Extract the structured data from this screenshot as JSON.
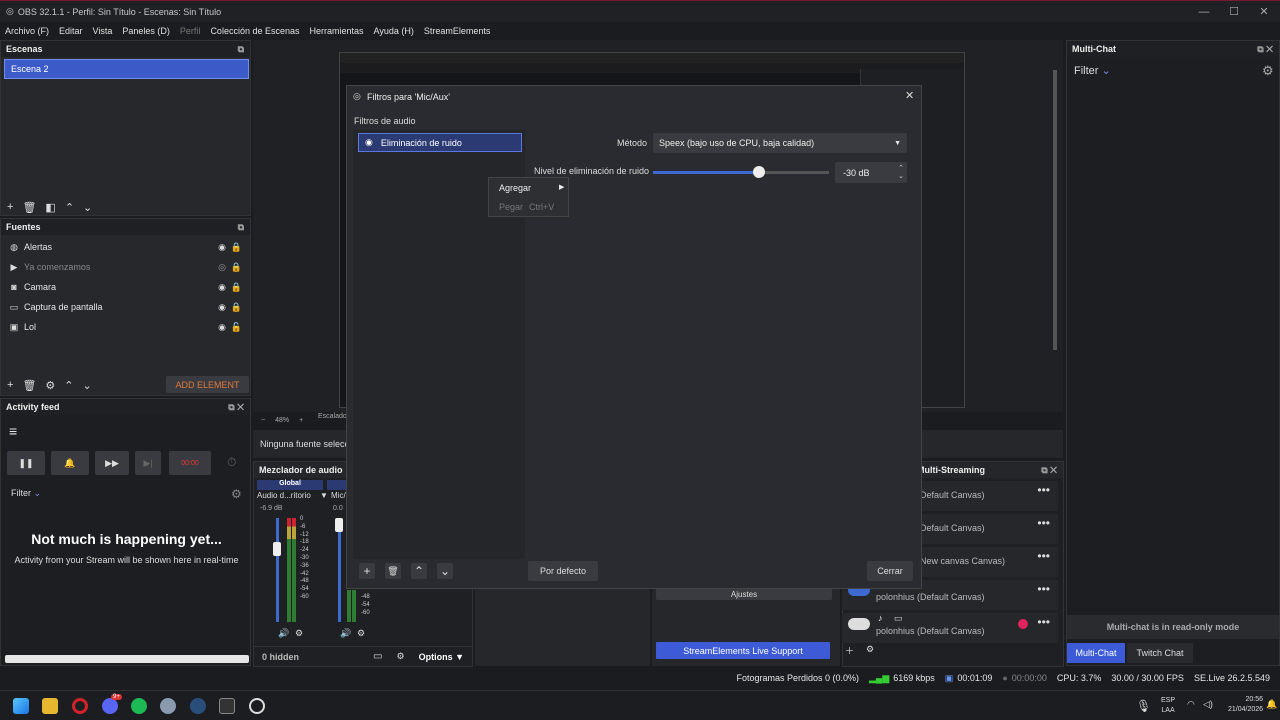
{
  "window": {
    "title": "OBS 32.1.1 - Perfil: Sin Título - Escenas: Sin Título",
    "min": "—",
    "max": "☐",
    "close": "✕"
  },
  "menu": [
    "Archivo (F)",
    "Editar",
    "Vista",
    "Paneles (D)",
    "Perfil",
    "Colección de Escenas",
    "Herramientas",
    "Ayuda (H)",
    "StreamElements"
  ],
  "scenes": {
    "title": "Escenas",
    "items": [
      "Escena 2"
    ]
  },
  "sources": {
    "title": "Fuentes",
    "items": [
      {
        "label": "Alertas",
        "icon": "globe-icon"
      },
      {
        "label": "Ya comenzamos",
        "icon": "play-icon",
        "hidden": true
      },
      {
        "label": "Camara",
        "icon": "camera-icon"
      },
      {
        "label": "Captura de pantalla",
        "icon": "monitor-icon"
      },
      {
        "label": "Lol",
        "icon": "window-icon"
      }
    ],
    "add_element": "ADD ELEMENT"
  },
  "activity": {
    "title": "Activity feed",
    "rec_time": "00:00",
    "filter": "Filter",
    "empty_title": "Not much is happening yet...",
    "empty_sub": "Activity from your Stream will be shown here in real-time"
  },
  "preview": {
    "zoom": "48%",
    "scale": "Escalado (",
    "no_source": "Ninguna fuente selecc"
  },
  "mixer": {
    "title": "Mezclador de audio",
    "global": "Global",
    "ch1": {
      "name": "Audio d...ritorio",
      "db": "-6.9 dB"
    },
    "ch2": {
      "name": "Mic/",
      "db": "0.0"
    },
    "scale": [
      "0",
      "-6",
      "-12",
      "-18",
      "-24",
      "-30",
      "-36",
      "-42",
      "-48",
      "-54",
      "-60"
    ],
    "hidden": "0 hidden",
    "options": "Options"
  },
  "dialog": {
    "title": "Filtros para 'Mic/Aux'",
    "section": "Filtros de audio",
    "filter_item": "Eliminación de ruido",
    "method_label": "Método",
    "method_value": "Speex (bajo uso de CPU, baja calidad)",
    "level_label": "Nivel de eliminación de ruido",
    "level_value": "-30 dB",
    "level_fraction": 0.6,
    "defaults": "Por defecto",
    "close": "Cerrar",
    "context": {
      "add": "Agregar",
      "paste": "Pegar",
      "paste_shortcut": "Ctrl+V"
    }
  },
  "controls": {
    "ajustes": "Ajustes",
    "support": "StreamElements Live Support"
  },
  "multistream": {
    "title": "Multi-Streaming",
    "rows": [
      "Default Canvas)",
      "Default Canvas)",
      "New canvas Canvas)",
      "polonhius (Default Canvas)",
      "polonhius (Default Canvas)"
    ]
  },
  "multichat": {
    "title": "Multi-Chat",
    "filter": "Filter",
    "readonly": "Multi-chat is in read-only mode",
    "tab1": "Multi-Chat",
    "tab2": "Twitch Chat"
  },
  "status": {
    "dropped": "Fotogramas Perdidos 0 (0.0%)",
    "bitrate": "6169 kbps",
    "rec": "00:01:09",
    "stream": "00:00:00",
    "cpu": "CPU: 3.7%",
    "fps": "30.00 / 30.00 FPS",
    "se": "SE.Live 26.2.5.549"
  },
  "taskbar": {
    "lang1": "ESP",
    "lang2": "LAA",
    "time": "20:56",
    "date": "21/04/2026",
    "discord_badge": "9+"
  },
  "colors": {
    "accent": "#3c5bc8",
    "brand_red": "#7a1830",
    "support": "#3d5bd6"
  }
}
